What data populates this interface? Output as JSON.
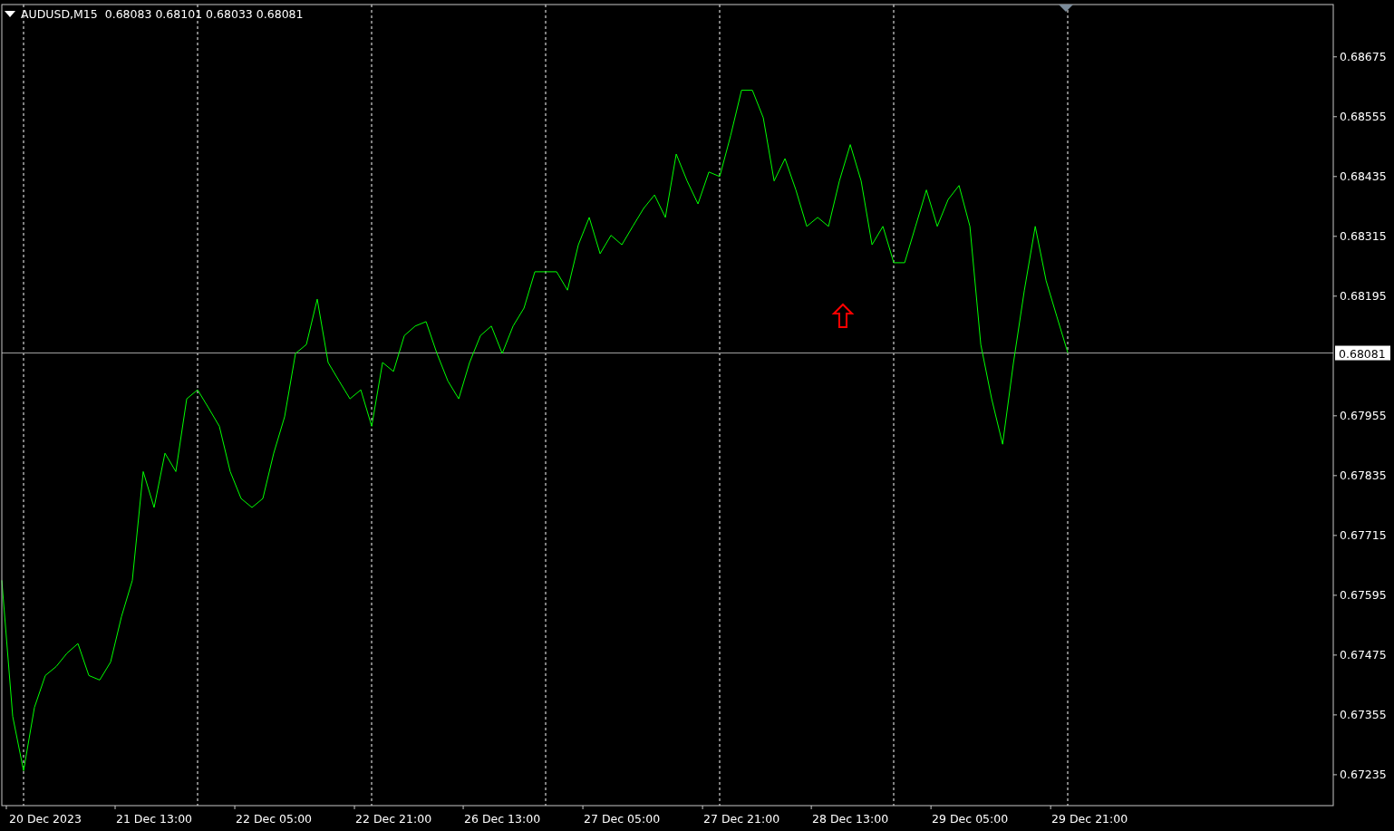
{
  "chart": {
    "ohlc": [
      "0.68083",
      "0.68101",
      "0.68033",
      "0.68081"
    ],
    "chart_data": {
      "type": "line",
      "grid": true,
      "ylim": [
        0.67173,
        0.6878
      ],
      "categories": [
        null,
        null,
        null,
        null,
        "20 Dec 2023",
        null,
        null,
        null,
        null,
        null,
        null,
        null,
        null,
        null,
        "21 Dec 13:00",
        null,
        null,
        null,
        null,
        null,
        null,
        null,
        null,
        null,
        null,
        "22 Dec 05:00",
        null,
        null,
        null,
        null,
        null,
        null,
        null,
        null,
        null,
        null,
        "22 Dec 21:00",
        null,
        null,
        null,
        null,
        null,
        null,
        null,
        null,
        null,
        "26 Dec 13:00",
        null,
        null,
        null,
        null,
        null,
        null,
        null,
        null,
        null,
        null,
        "27 Dec 05:00",
        null,
        null,
        null,
        null,
        null,
        null,
        null,
        null,
        null,
        null,
        "27 Dec 21:00",
        null,
        null,
        null,
        null,
        null,
        null,
        null,
        null,
        null,
        "28 Dec 13:00",
        null,
        null,
        null,
        null,
        null,
        null,
        null,
        null,
        null,
        null,
        "29 Dec 05:00",
        null,
        null,
        null,
        null,
        null,
        null,
        null,
        null,
        null,
        null,
        "29 Dec 21:00"
      ],
      "series": [
        {
          "name": "AUDUSD,M15",
          "color": "#00ff00",
          "values": [
            0.67625,
            0.67352,
            0.67243,
            0.6737,
            0.67434,
            0.67452,
            0.67479,
            0.67498,
            0.67434,
            0.67425,
            0.67461,
            0.67552,
            0.67625,
            0.67843,
            0.67771,
            0.6788,
            0.67843,
            0.67989,
            0.68007,
            0.67971,
            0.67934,
            0.67843,
            0.67789,
            0.67771,
            0.67789,
            0.6788,
            0.67953,
            0.6808,
            0.68098,
            0.68189,
            0.68062,
            0.68025,
            0.67989,
            0.68007,
            0.67934,
            0.68062,
            0.68044,
            0.68116,
            0.68135,
            0.68144,
            0.6808,
            0.68025,
            0.67989,
            0.68062,
            0.68116,
            0.68135,
            0.6808,
            0.68135,
            0.68171,
            0.68244,
            0.68244,
            0.68244,
            0.68207,
            0.68298,
            0.68353,
            0.6828,
            0.68317,
            0.68298,
            0.68335,
            0.68371,
            0.68398,
            0.68353,
            0.6848,
            0.68426,
            0.6838,
            0.68444,
            0.68435,
            0.68517,
            0.68608,
            0.68608,
            0.68553,
            0.68426,
            0.68471,
            0.68408,
            0.68335,
            0.68353,
            0.68335,
            0.68426,
            0.68499,
            0.68426,
            0.68298,
            0.68335,
            0.68262,
            0.68262,
            0.68335,
            0.68408,
            0.68335,
            0.68389,
            0.68417,
            0.68335,
            0.68098,
            0.67989,
            0.67898,
            0.68062,
            0.68207,
            0.68335,
            0.68226,
            0.68153,
            0.68081,
            null,
            null
          ]
        }
      ],
      "yticks": [
        {
          "value": 0.68675,
          "label": "0.68675"
        },
        {
          "value": 0.68555,
          "label": "0.68555"
        },
        {
          "value": 0.68435,
          "label": "0.68435"
        },
        {
          "value": 0.68315,
          "label": "0.68315"
        },
        {
          "value": 0.68195,
          "label": "0.68195"
        },
        {
          "value": 0.67955,
          "label": "0.67955"
        },
        {
          "value": 0.67835,
          "label": "0.67835"
        },
        {
          "value": 0.67715,
          "label": "0.67715"
        },
        {
          "value": 0.67595,
          "label": "0.67595"
        },
        {
          "value": 0.67475,
          "label": "0.67475"
        },
        {
          "value": 0.67355,
          "label": "0.67355"
        },
        {
          "value": 0.67235,
          "label": "0.67235"
        }
      ],
      "ref_lines": [
        {
          "axis": "y",
          "value": 0.68081,
          "label": "0.68081"
        }
      ]
    }
  }
}
